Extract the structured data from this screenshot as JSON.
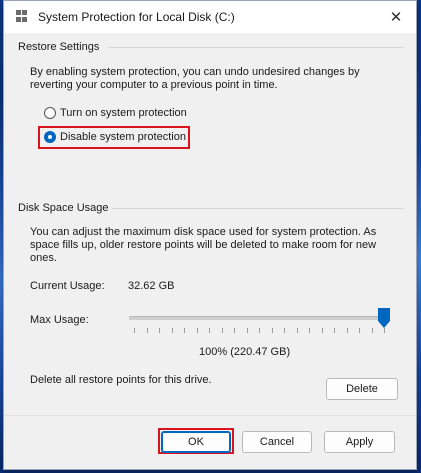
{
  "window": {
    "title": "System Protection for Local Disk (C:)",
    "close_glyph": "✕"
  },
  "restore_settings": {
    "heading": "Restore Settings",
    "description": "By enabling system protection, you can undo undesired changes by reverting your computer to a previous point in time.",
    "options": [
      {
        "label": "Turn on system protection",
        "selected": false
      },
      {
        "label": "Disable system protection",
        "selected": true
      }
    ]
  },
  "disk_space": {
    "heading": "Disk Space Usage",
    "description": "You can adjust the maximum disk space used for system protection. As space fills up, older restore points will be deleted to make room for new ones.",
    "current_label": "Current Usage:",
    "current_value": "32.62 GB",
    "max_label": "Max Usage:",
    "max_percent": 100,
    "max_readout": "100% (220.47 GB)",
    "delete_text": "Delete all restore points for this drive.",
    "delete_button": "Delete"
  },
  "buttons": {
    "ok": "OK",
    "cancel": "Cancel",
    "apply": "Apply"
  },
  "colors": {
    "accent": "#0067c0",
    "highlight_box": "#d9141c"
  }
}
